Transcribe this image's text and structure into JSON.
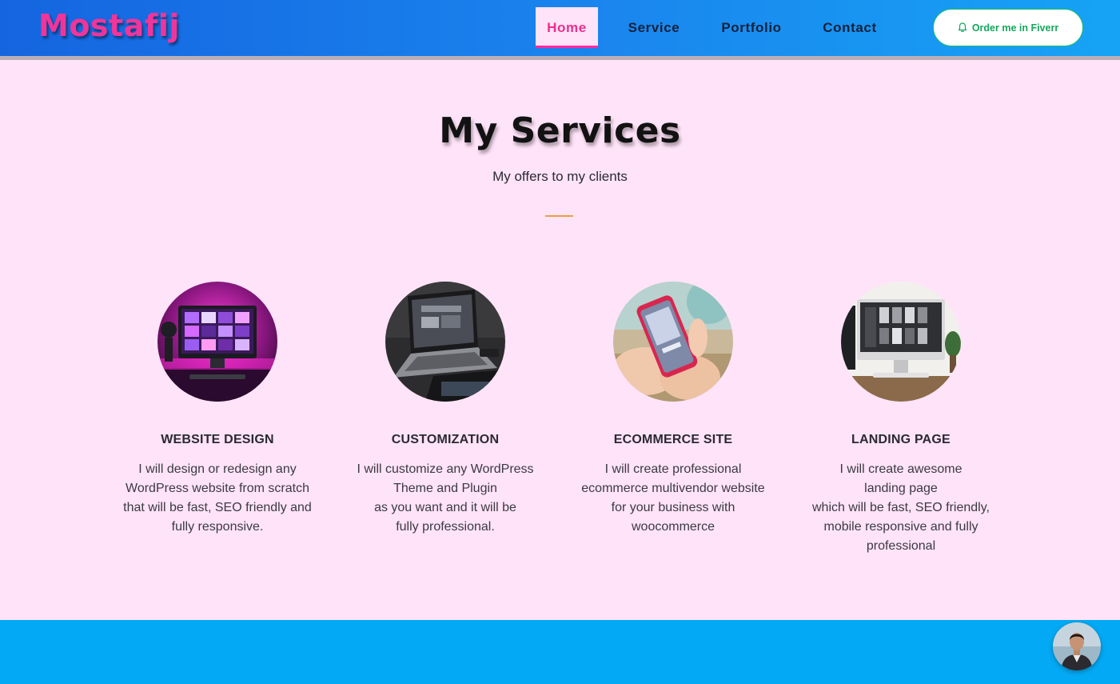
{
  "navbar": {
    "brand": "Mostafij",
    "items": [
      {
        "label": "Home",
        "active": true
      },
      {
        "label": "Service",
        "active": false
      },
      {
        "label": "Portfolio",
        "active": false
      },
      {
        "label": "Contact",
        "active": false
      }
    ],
    "cta_label": "Order me in Fiverr",
    "cta_icon": "bell-icon"
  },
  "services": {
    "title": "My Services",
    "subtitle": "My offers to my clients",
    "cards": [
      {
        "title": "WEBSITE DESIGN",
        "image": "imac-purple-desk-image",
        "lines": [
          "I will design or redesign any",
          "WordPress website from scratch",
          "that will be fast, SEO friendly and",
          "fully responsive."
        ]
      },
      {
        "title": "CUSTOMIZATION",
        "image": "laptop-dark-desk-image",
        "lines": [
          "I will customize any WordPress",
          "Theme and Plugin",
          "as you want and it will be",
          "fully professional."
        ]
      },
      {
        "title": "ECOMMERCE SITE",
        "image": "phone-in-hand-image",
        "lines": [
          "I will create professional",
          "ecommerce multivendor website",
          "for your business with",
          "woocommerce"
        ]
      },
      {
        "title": "LANDING PAGE",
        "image": "imac-white-desk-image",
        "lines": [
          "I will create awesome",
          "landing page",
          "which will be fast, SEO friendly,",
          "mobile responsive and fully",
          "professional"
        ]
      }
    ]
  },
  "colors": {
    "brand_pink": "#f0359a",
    "nav_gradient_start": "#1565e0",
    "page_bg": "#ffe3f8",
    "accent_orange": "#e8a13a",
    "cta_green": "#14a85c",
    "band_blue": "#03a9f4"
  }
}
